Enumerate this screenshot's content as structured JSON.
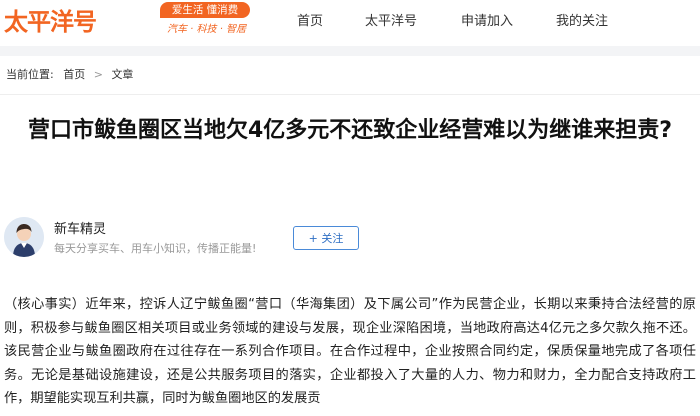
{
  "header": {
    "logo_text": "太平洋号",
    "logo_badge": "爱生活 懂消费",
    "logo_sub": "汽车 · 科技 · 智居",
    "nav": [
      "首页",
      "太平洋号",
      "申请加入",
      "我的关注"
    ]
  },
  "breadcrumb": {
    "label": "当前位置:",
    "items": [
      "首页",
      "文章"
    ]
  },
  "article": {
    "title": "营口市鲅鱼圈区当地欠4亿多元不还致企业经营难以为继谁来担责?",
    "author": {
      "name": "新车精灵",
      "desc": "每天分享买车、用车小知识，传播正能量!",
      "follow_label": "+ 关注"
    },
    "body": "（核心事实）近年来，控诉人辽宁鲅鱼圈“营口（华海集团）及下属公司”作为民营企业，长期以来秉持合法经营的原则，积极参与鲅鱼圈区相关项目或业务领域的建设与发展，现企业深陷困境，当地政府高达4亿元之多欠款久拖不还。该民营企业与鲅鱼圈政府在过往存在一系列合作项目。在合作过程中，企业按照合同约定，保质保量地完成了各项任务。无论是基础设施建设，还是公共服务项目的落实，企业都投入了大量的人力、物力和财力，全力配合支持政府工作，期望能实现互利共赢，同时为鲅鱼圈地区的发展贡"
  },
  "colors": {
    "brand": "#f26522",
    "follow": "#2f6fc4"
  }
}
